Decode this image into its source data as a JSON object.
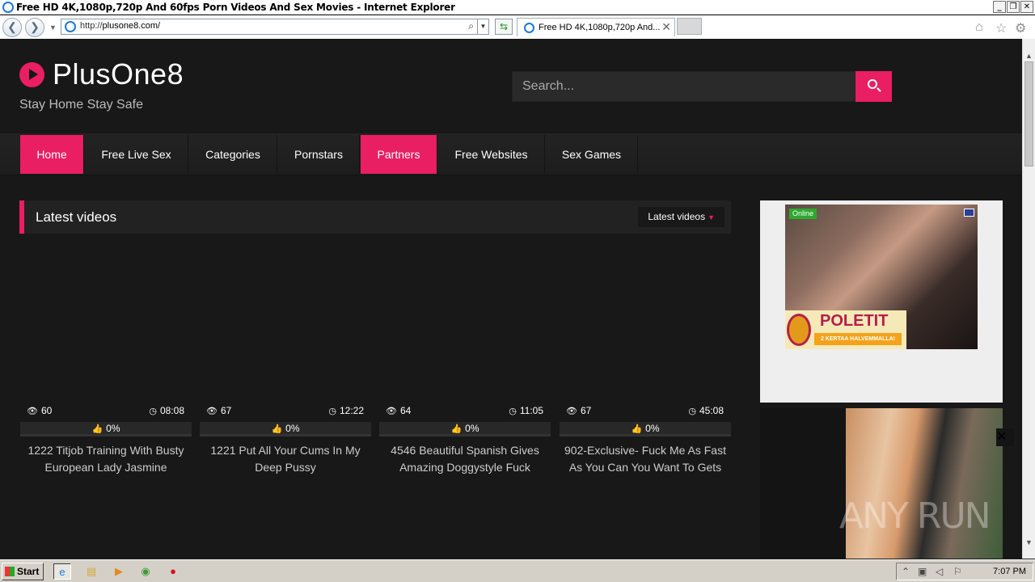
{
  "window": {
    "title": "Free HD 4K,1080p,720p And 60fps Porn Videos And Sex Movies - Internet Explorer",
    "min": "_",
    "restore": "❐",
    "close": "✕"
  },
  "browser": {
    "url_prefix": "http://",
    "url_host": "plusone8.com/",
    "tab_label": "Free HD 4K,1080p,720p And...",
    "tab_close": "✕",
    "back_glyph": "❮",
    "forward_glyph": "❯",
    "search_glyph": "⌕",
    "dropdown_glyph": "▼",
    "refresh_glyph": "⇆",
    "home_glyph": "⌂",
    "favorites_glyph": "☆",
    "settings_glyph": "⚙"
  },
  "site": {
    "logo": "PlusOne8",
    "tagline": "Stay Home Stay Safe",
    "search_placeholder": "Search...",
    "nav": [
      {
        "label": "Home",
        "active": true
      },
      {
        "label": "Free Live Sex",
        "active": false
      },
      {
        "label": "Categories",
        "active": false
      },
      {
        "label": "Pornstars",
        "active": false
      },
      {
        "label": "Partners",
        "active": true
      },
      {
        "label": "Free Websites",
        "active": false
      },
      {
        "label": "Sex Games",
        "active": false
      }
    ],
    "section_title": "Latest videos",
    "filter_label": "Latest videos",
    "videos": [
      {
        "views": "60",
        "duration": "08:08",
        "rating": "0%",
        "title": "1222 Titjob Training With Busty European Lady Jasmine"
      },
      {
        "views": "67",
        "duration": "12:22",
        "rating": "0%",
        "title": "1221 Put All Your Cums In My Deep Pussy"
      },
      {
        "views": "64",
        "duration": "11:05",
        "rating": "0%",
        "title": "4546 Beautiful Spanish Gives Amazing Doggystyle Fuck"
      },
      {
        "views": "67",
        "duration": "45:08",
        "rating": "0%",
        "title": "902-Exclusive- Fuck Me As Fast As You Can You Want To Gets"
      }
    ],
    "ad1": {
      "online": "Online",
      "banner_title": "POLETIT",
      "banner_sub": "2 KERTAA HALVEMMALLA!"
    },
    "ad2": {
      "close": "✕"
    },
    "watermark": "ANY RUN"
  },
  "taskbar": {
    "start": "Start",
    "clock": "7:07 PM"
  },
  "colors": {
    "accent": "#e91e63",
    "background": "#181818",
    "navbar": "#232323"
  }
}
